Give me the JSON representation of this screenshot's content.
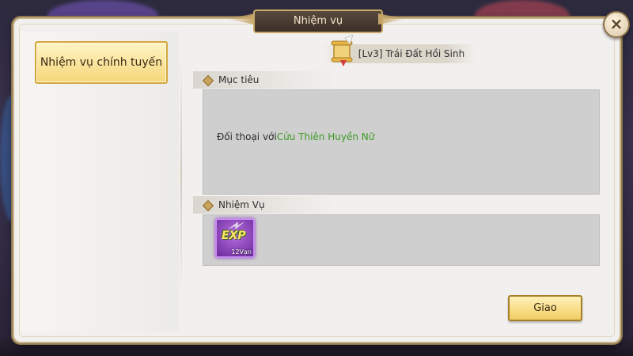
{
  "dialog": {
    "title": "Nhiệm vụ",
    "close_icon": "×"
  },
  "tabs": [
    {
      "label": "Nhiệm vụ chính tuyến",
      "selected": true
    }
  ],
  "quest": {
    "name": "[Lv3] Trái Đất Hồi Sinh",
    "icon": "scroll-quest-icon"
  },
  "goal": {
    "header": "Mục tiêu",
    "text_prefix": "Đối thoại với",
    "npc_name": "Cửu Thiên Huyền Nữ",
    "npc_color": "#3c9a25"
  },
  "reward": {
    "header": "Nhiệm Vụ",
    "item_label": "EXP",
    "item_qty": "12Vạn",
    "item_icon": "exp-icon"
  },
  "actions": {
    "accept_label": "Giao"
  },
  "colors": {
    "accent_gold": "#f2cd63",
    "panel_bg": "#f2f0ee",
    "box_bg": "#cfcfcf"
  }
}
